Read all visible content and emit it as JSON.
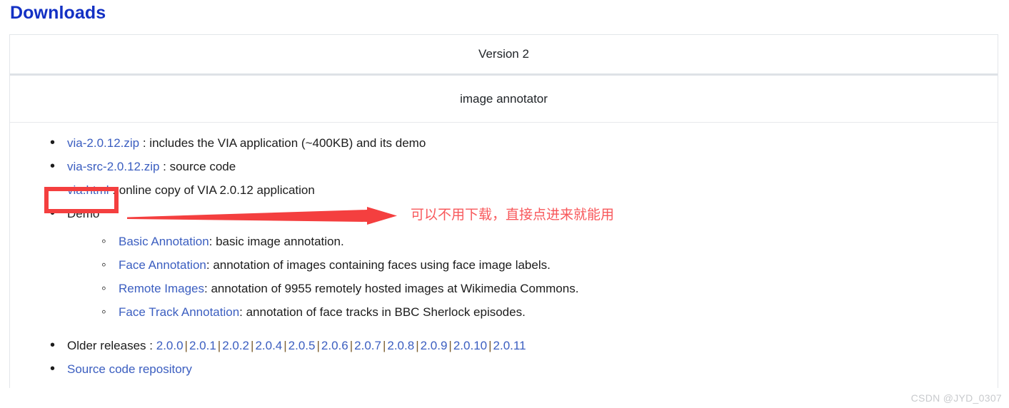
{
  "page": {
    "title": "Downloads",
    "title_color": "#1331c4",
    "link_color": "#3b5ec0",
    "watermark": "CSDN @JYD_0307"
  },
  "table": {
    "version_header": "Version 2",
    "subtitle": "image annotator",
    "items": [
      {
        "link": "via-2.0.12.zip",
        "description": " : includes the VIA application (~400KB) and its demo"
      },
      {
        "link": "via-src-2.0.12.zip",
        "description": " : source code"
      },
      {
        "link": "via.html",
        "description": " : online copy of VIA 2.0.12 application"
      }
    ],
    "demo": {
      "label": "Demo",
      "items": [
        {
          "link": "Basic Annotation",
          "description": ": basic image annotation."
        },
        {
          "link": "Face Annotation",
          "description": ": annotation of images containing faces using face image labels."
        },
        {
          "link": "Remote Images",
          "description": ": annotation of 9955 remotely hosted images at Wikimedia Commons."
        },
        {
          "link": "Face Track Annotation",
          "description": ": annotation of face tracks in BBC Sherlock episodes."
        }
      ]
    },
    "older_releases": {
      "label": "Older releases : ",
      "versions": [
        "2.0.0",
        "2.0.1",
        "2.0.2",
        "2.0.4",
        "2.0.5",
        "2.0.6",
        "2.0.7",
        "2.0.8",
        "2.0.9",
        "2.0.10",
        "2.0.11"
      ],
      "separator": "|"
    },
    "source_repo": "Source code repository"
  },
  "annotation": {
    "text": "可以不用下载，直接点进来就能用",
    "color": "#f8585b",
    "box_color": "#f43f3f",
    "arrow_color": "#f43f3f",
    "highlights": "via.html"
  }
}
